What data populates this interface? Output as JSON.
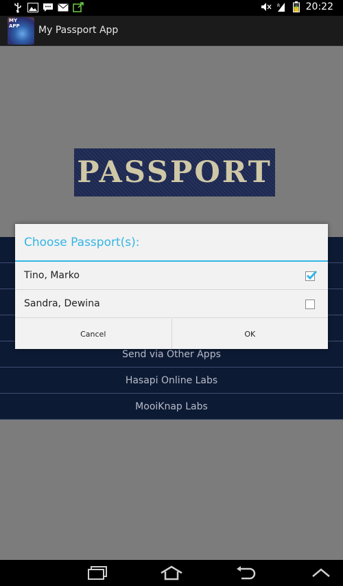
{
  "status_bar": {
    "time": "20:22",
    "left_icons": [
      "usb-icon",
      "image-icon",
      "chat-icon",
      "mail-icon",
      "sync-icon"
    ],
    "right_icons": [
      "mute-icon",
      "signal-icon",
      "battery-icon"
    ]
  },
  "action_bar": {
    "app_icon_text": "MY\nAPP",
    "title": "My Passport App"
  },
  "banner": {
    "text": "PASSPORT"
  },
  "menu": {
    "items": [
      {
        "label": ""
      },
      {
        "label": ""
      },
      {
        "label": ""
      },
      {
        "label": ""
      },
      {
        "label": "Send via Other Apps"
      },
      {
        "label": "Hasapi Online Labs"
      },
      {
        "label": "MooiKnap Labs"
      }
    ]
  },
  "dialog": {
    "title": "Choose Passport(s):",
    "items": [
      {
        "label": "Tino, Marko",
        "checked": true
      },
      {
        "label": "Sandra, Dewina",
        "checked": false
      }
    ],
    "cancel_label": "Cancel",
    "ok_label": "OK"
  },
  "nav_bar": {
    "icons": [
      "recent-apps-icon",
      "home-icon",
      "back-icon",
      "menu-up-icon"
    ]
  },
  "colors": {
    "accent": "#33b5e5",
    "menu_bg": "#0d1a33",
    "dim_bg": "#7c7c7c",
    "passport_blue": "#1e2a54",
    "passport_gold": "#cfc8a6"
  }
}
